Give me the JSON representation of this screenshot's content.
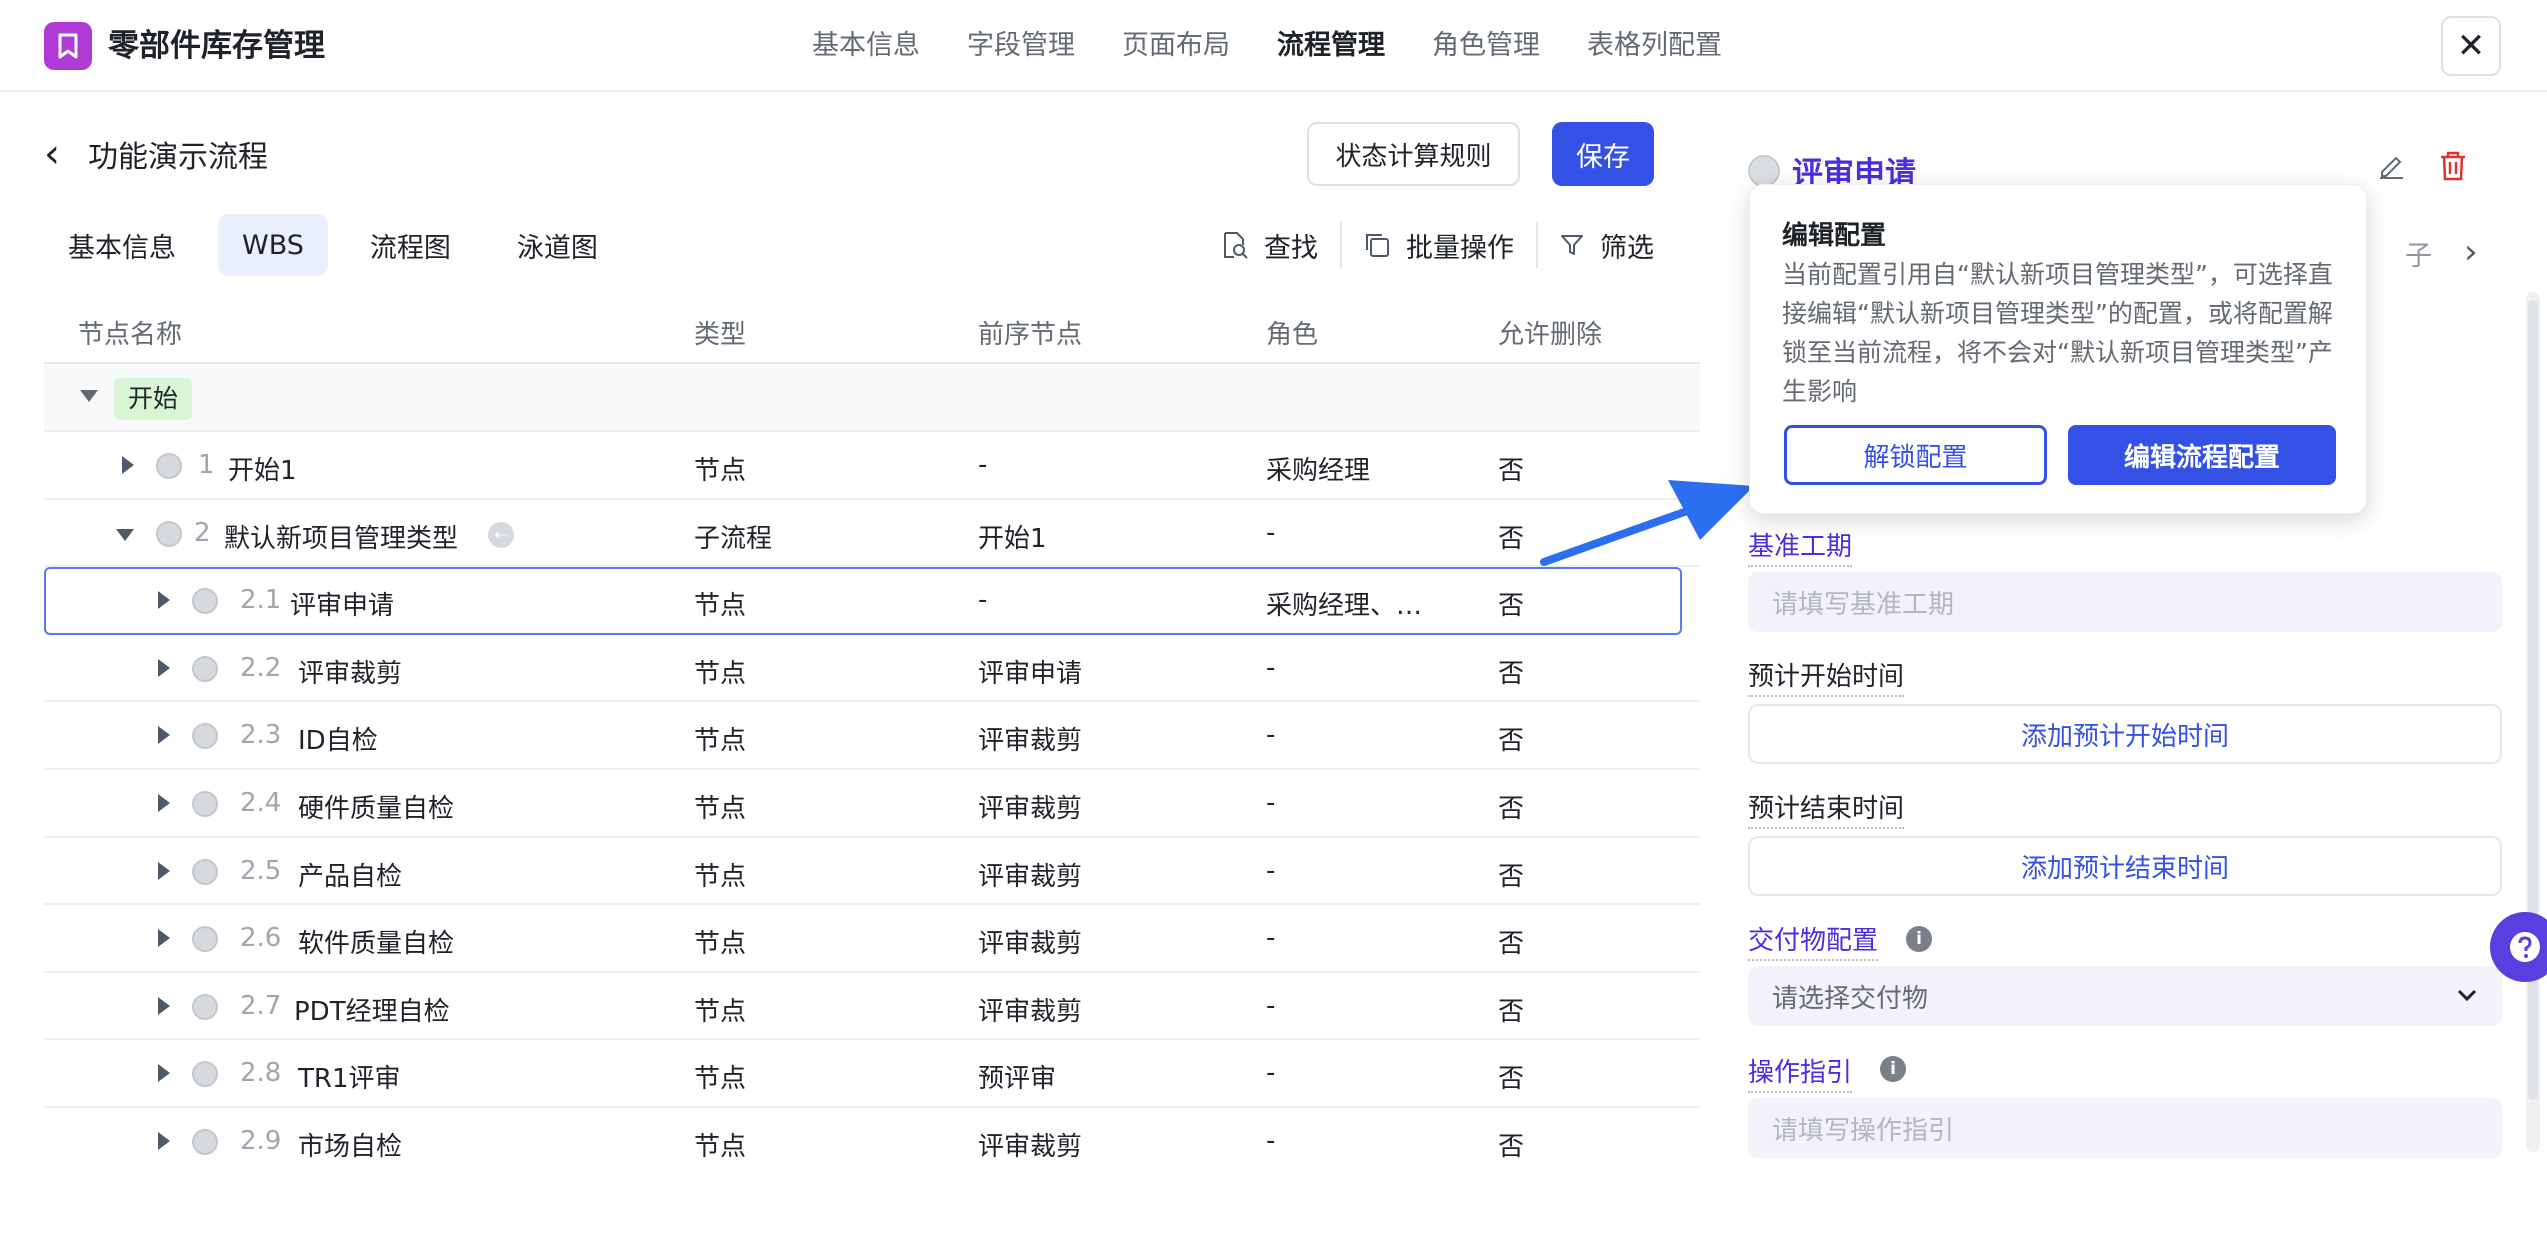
{
  "app": {
    "title": "零部件库存管理",
    "brand_color": "#b13ad6"
  },
  "topnav": {
    "items": [
      "基本信息",
      "字段管理",
      "页面布局",
      "流程管理",
      "角色管理",
      "表格列配置"
    ],
    "active": "流程管理"
  },
  "page": {
    "title": "功能演示流程",
    "rule_button": "状态计算规则",
    "save_button": "保存"
  },
  "subtabs": {
    "items": [
      "基本信息",
      "WBS",
      "流程图",
      "泳道图"
    ],
    "active": "WBS"
  },
  "tools": {
    "find": "查找",
    "batch": "批量操作",
    "filter": "筛选"
  },
  "table": {
    "columns": [
      "节点名称",
      "类型",
      "前序节点",
      "角色",
      "允许删除"
    ],
    "group": "开始",
    "rows": [
      {
        "num": "1",
        "name": "开始1",
        "type": "节点",
        "prev": "-",
        "role": "采购经理",
        "deletable": "否"
      },
      {
        "num": "2",
        "name": "默认新项目管理类型",
        "type": "子流程",
        "prev": "开始1",
        "role": "-",
        "deletable": "否"
      },
      {
        "num": "2.1",
        "name": "评审申请",
        "type": "节点",
        "prev": "-",
        "role": "采购经理、…",
        "deletable": "否"
      },
      {
        "num": "2.2",
        "name": "评审裁剪",
        "type": "节点",
        "prev": "评审申请",
        "role": "-",
        "deletable": "否"
      },
      {
        "num": "2.3",
        "name": "ID自检",
        "type": "节点",
        "prev": "评审裁剪",
        "role": "-",
        "deletable": "否"
      },
      {
        "num": "2.4",
        "name": "硬件质量自检",
        "type": "节点",
        "prev": "评审裁剪",
        "role": "-",
        "deletable": "否"
      },
      {
        "num": "2.5",
        "name": "产品自检",
        "type": "节点",
        "prev": "评审裁剪",
        "role": "-",
        "deletable": "否"
      },
      {
        "num": "2.6",
        "name": "软件质量自检",
        "type": "节点",
        "prev": "评审裁剪",
        "role": "-",
        "deletable": "否"
      },
      {
        "num": "2.7",
        "name": "PDT经理自检",
        "type": "节点",
        "prev": "评审裁剪",
        "role": "-",
        "deletable": "否"
      },
      {
        "num": "2.8",
        "name": "TR1评审",
        "type": "节点",
        "prev": "预评审",
        "role": "-",
        "deletable": "否"
      },
      {
        "num": "2.9",
        "name": "市场自检",
        "type": "节点",
        "prev": "评审裁剪",
        "role": "-",
        "deletable": "否"
      }
    ]
  },
  "panel": {
    "title": "评审申请",
    "tab_fragment": "子",
    "fields": {
      "baseline_label": "基准工期",
      "baseline_placeholder": "请填写基准工期",
      "plan_start_label": "预计开始时间",
      "plan_start_button": "添加预计开始时间",
      "plan_end_label": "预计结束时间",
      "plan_end_button": "添加预计结束时间",
      "deliverable_label": "交付物配置",
      "deliverable_placeholder": "请选择交付物",
      "guide_label": "操作指引",
      "guide_placeholder": "请填写操作指引"
    }
  },
  "popover": {
    "title": "编辑配置",
    "body": "当前配置引用自“默认新项目管理类型”，可选择直接编辑“默认新项目管理类型”的配置，或将配置解锁至当前流程，将不会对“默认新项目管理类型”产生影响",
    "unlock_button": "解锁配置",
    "edit_flow_button": "编辑流程配置"
  },
  "colors": {
    "primary": "#3451e6",
    "accent_text": "#4c2de0",
    "start_tag": "#d9f5d6"
  }
}
